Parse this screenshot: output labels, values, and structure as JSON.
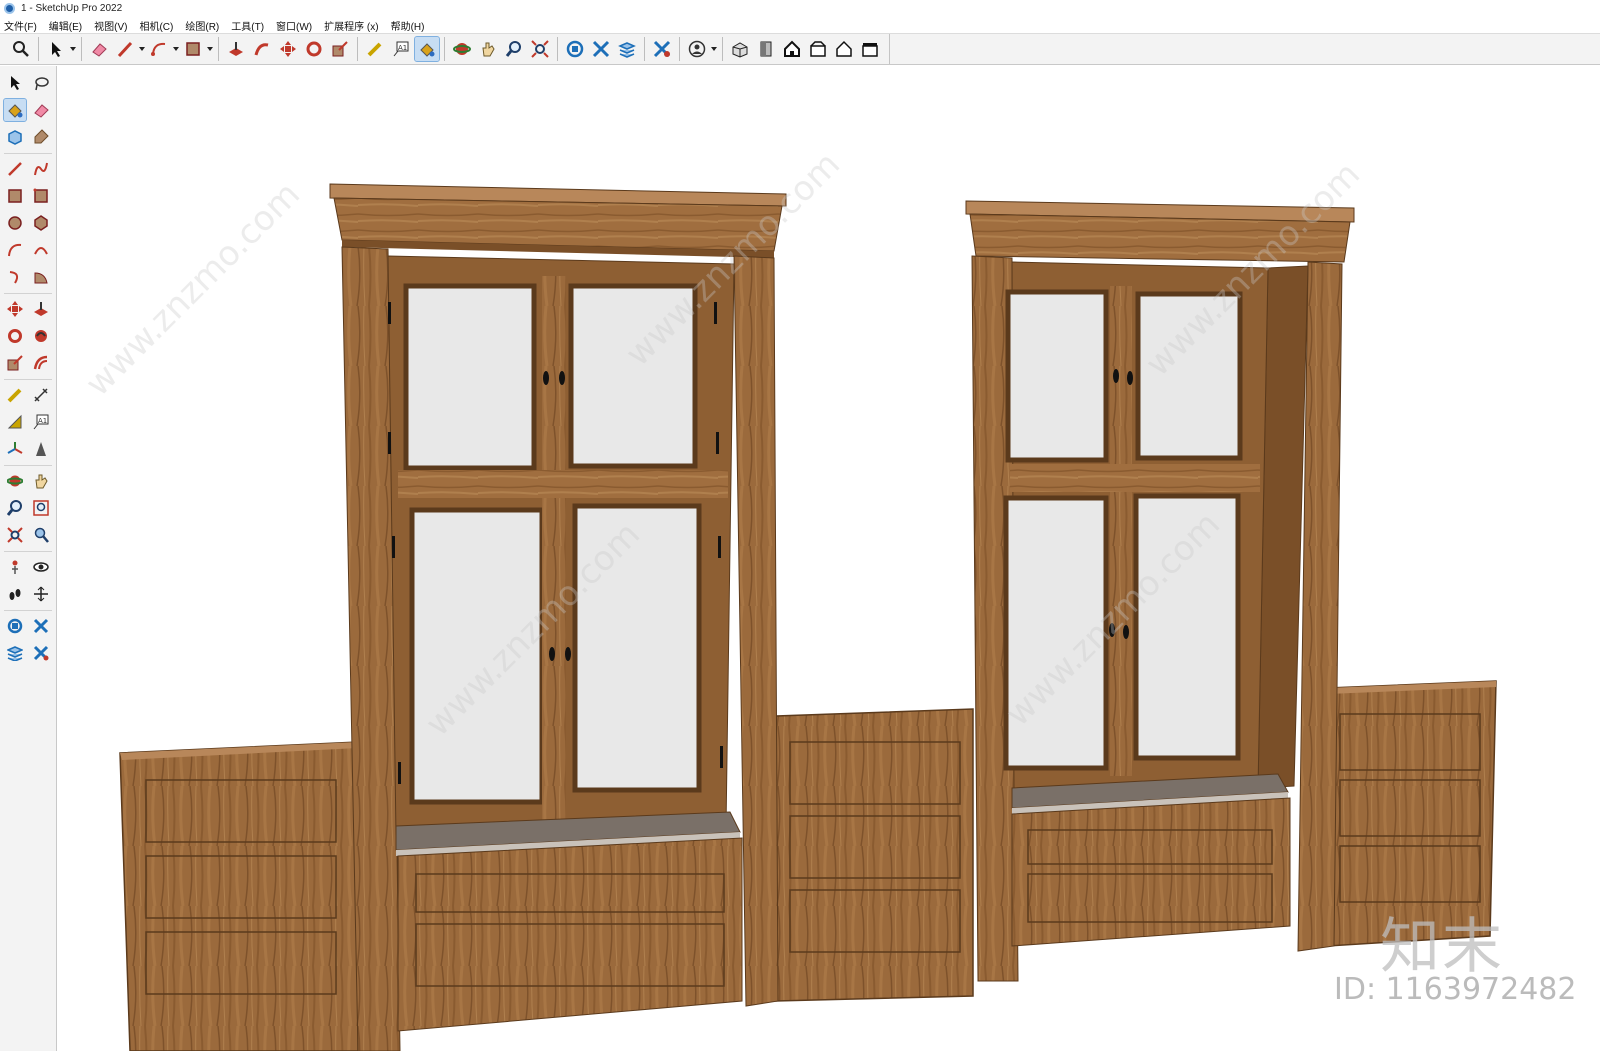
{
  "window": {
    "title": "1 - SketchUp Pro 2022"
  },
  "menu": [
    "文件(F)",
    "编辑(E)",
    "视图(V)",
    "相机(C)",
    "绘图(R)",
    "工具(T)",
    "窗口(W)",
    "扩展程序 (x)",
    "帮助(H)"
  ],
  "toolbar": {
    "tools": [
      {
        "name": "zoom-window-icon",
        "glyph": "🔍"
      },
      {
        "name": "select-icon",
        "glyph": "↖"
      },
      {
        "name": "eraser-icon",
        "glyph": "▰"
      },
      {
        "name": "pencil-icon",
        "glyph": "✎"
      },
      {
        "name": "arc-icon",
        "glyph": "◠"
      },
      {
        "name": "rectangle-icon",
        "glyph": "▦"
      },
      {
        "name": "push-pull-icon",
        "glyph": "◆"
      },
      {
        "name": "follow-me-icon",
        "glyph": "➤"
      },
      {
        "name": "move-icon",
        "glyph": "✥"
      },
      {
        "name": "rotate-icon",
        "glyph": "⟳"
      },
      {
        "name": "scale-icon",
        "glyph": "⤢"
      },
      {
        "name": "tape-measure-icon",
        "glyph": "📏"
      },
      {
        "name": "text-icon",
        "glyph": "A1"
      },
      {
        "name": "paint-bucket-icon",
        "glyph": "🪣"
      },
      {
        "name": "orbit-icon",
        "glyph": "↻"
      },
      {
        "name": "pan-icon",
        "glyph": "✋"
      },
      {
        "name": "zoom-icon",
        "glyph": "🔎"
      },
      {
        "name": "zoom-extents-icon",
        "glyph": "⤧"
      },
      {
        "name": "3d-warehouse-icon",
        "glyph": "⬡"
      },
      {
        "name": "extension-warehouse-icon",
        "glyph": "✕"
      },
      {
        "name": "layout-icon",
        "glyph": "≋"
      },
      {
        "name": "extension-manager-icon",
        "glyph": "✕"
      },
      {
        "name": "account-icon",
        "glyph": "◉"
      },
      {
        "name": "iso-view-icon",
        "glyph": "⌂"
      },
      {
        "name": "top-view-icon",
        "glyph": "▯"
      },
      {
        "name": "front-view-icon",
        "glyph": "⌂"
      },
      {
        "name": "right-view-icon",
        "glyph": "⊡"
      },
      {
        "name": "back-view-icon",
        "glyph": "⌂"
      },
      {
        "name": "left-view-icon",
        "glyph": "⊟"
      }
    ]
  },
  "colors": {
    "accent": "#1f5fa8",
    "wood": "#9b6a3c",
    "wood_dark": "#6e4622",
    "glass": "#e8e8e8"
  },
  "watermark": {
    "logo": "知末",
    "id": "ID: 1163972482"
  }
}
